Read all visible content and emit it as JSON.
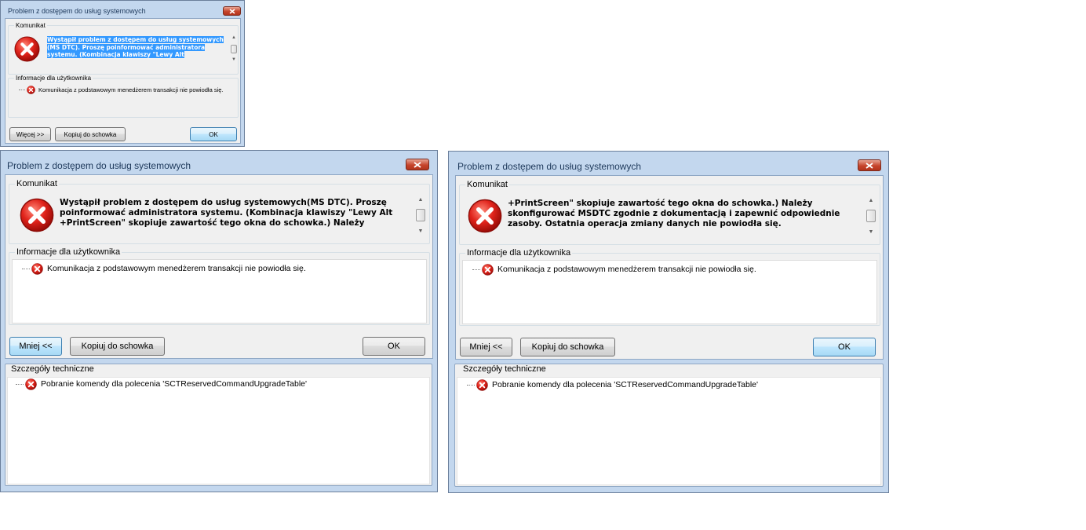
{
  "small": {
    "title": "Problem z dostępem do usług systemowych",
    "message_group_label": "Komunikat",
    "message_lines": [
      "Wystąpił problem z dostępem do usług systemowych",
      "(MS DTC). Proszę poinformować administratora",
      "systemu.  (Kombinacja klawiszy \"Lewy Alt"
    ],
    "info_group_label": "Informacje dla użytkownika",
    "info_item": "Komunikacja z podstawowym menedżerem transakcji nie powiodła się.",
    "more_button": "Więcej >>",
    "copy_button": "Kopiuj do schowka",
    "ok_button": "OK"
  },
  "left": {
    "title": "Problem z dostępem do usług systemowych",
    "message_group_label": "Komunikat",
    "message_text": "Wystąpił problem z dostępem do usług systemowych(MS DTC). Proszę\npoinformować administratora systemu.  (Kombinacja klawiszy \"Lewy Alt\n+PrintScreen\" skopiuje zawartość tego okna do schowka.) Należy",
    "info_group_label": "Informacje dla użytkownika",
    "info_item": "Komunikacja z podstawowym menedżerem transakcji nie powiodła się.",
    "less_button": "Mniej <<",
    "copy_button": "Kopiuj do schowka",
    "ok_button": "OK",
    "tech_group_label": "Szczegóły techniczne",
    "tech_item": "Pobranie komendy dla polecenia 'SCTReservedCommandUpgradeTable'"
  },
  "right": {
    "title": "Problem z dostępem do usług systemowych",
    "message_group_label": "Komunikat",
    "message_text": "+PrintScreen\" skopiuje zawartość tego okna do schowka.) Należy\nskonfigurować MSDTC zgodnie z dokumentacją i zapewnić odpowiednie\nzasoby.  Ostatnia operacja zmiany danych nie powiodła się.",
    "info_group_label": "Informacje dla użytkownika",
    "info_item": "Komunikacja z podstawowym menedżerem transakcji nie powiodła się.",
    "less_button": "Mniej <<",
    "copy_button": "Kopiuj do schowka",
    "ok_button": "OK",
    "tech_group_label": "Szczegóły techniczne",
    "tech_item": "Pobranie komendy dla polecenia 'SCTReservedCommandUpgradeTable'"
  },
  "colors": {
    "frame": "#c3d7ee",
    "selection": "#3399ff",
    "error_red": "#d0201c",
    "close_red": "#c6452c"
  }
}
